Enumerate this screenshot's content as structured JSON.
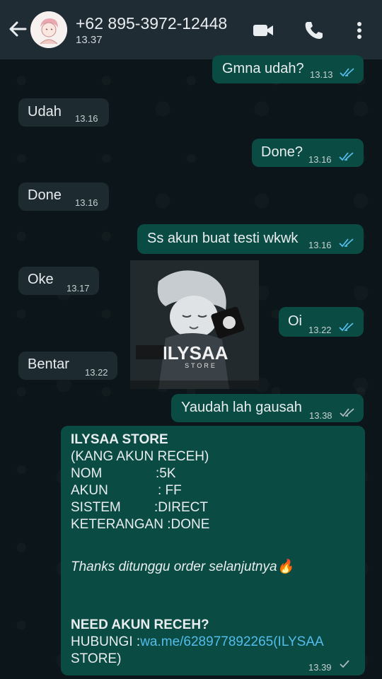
{
  "header": {
    "contact_name": "+62 895-3972-12448",
    "last_seen": "13.37",
    "icons": [
      "back-arrow-icon",
      "video-call-icon",
      "phone-icon",
      "more-vert-icon"
    ]
  },
  "messages": [
    {
      "side": "out",
      "text": "Gmna udah?",
      "time": "13.13",
      "status": "read"
    },
    {
      "side": "in",
      "text": "Udah",
      "time": "13.16"
    },
    {
      "side": "out",
      "text": "Done?",
      "time": "13.16",
      "status": "read"
    },
    {
      "side": "in",
      "text": "Done",
      "time": "13.16"
    },
    {
      "side": "out",
      "text": "Ss akun buat testi wkwk",
      "time": "13.16",
      "status": "read"
    },
    {
      "side": "in",
      "text": "Oke",
      "time": "13.17"
    },
    {
      "side": "out",
      "text": "Oi",
      "time": "13.22",
      "status": "read"
    },
    {
      "side": "in",
      "text": "Bentar",
      "time": "13.22"
    },
    {
      "side": "out",
      "text": "Yaudah lah gausah",
      "time": "13.38",
      "status": "delivered"
    }
  ],
  "image_message": {
    "logo_text": "ILYSAA",
    "logo_sub": "STORE"
  },
  "long_message": {
    "line1": "ILYSAA STORE",
    "line2": "(KANG AKUN RECEH)",
    "line3_label": "NOM",
    "line3_value": ":5K",
    "line4_label": "AKUN",
    "line4_value": ": FF",
    "line5_label": "SISTEM",
    "line5_value": ":DIRECT",
    "line6": "KETERANGAN :DONE",
    "thanks": "Thanks ditunggu order selanjutnya",
    "thanks_emoji": "🔥",
    "need": "NEED AKUN RECEH?",
    "contact_prefix": "HUBUNGI :",
    "contact_link": "wa.me/628977892265",
    "contact_suffix": "(ILYSAA",
    "contact_suffix2": "STORE)",
    "time": "13.39",
    "status": "sent"
  },
  "colors": {
    "header_bg": "#1f2c34",
    "outgoing_bubble": "#0a4b43",
    "incoming_bubble": "#1d2a30",
    "read_ticks": "#53bdeb",
    "link": "#53bdeb"
  }
}
